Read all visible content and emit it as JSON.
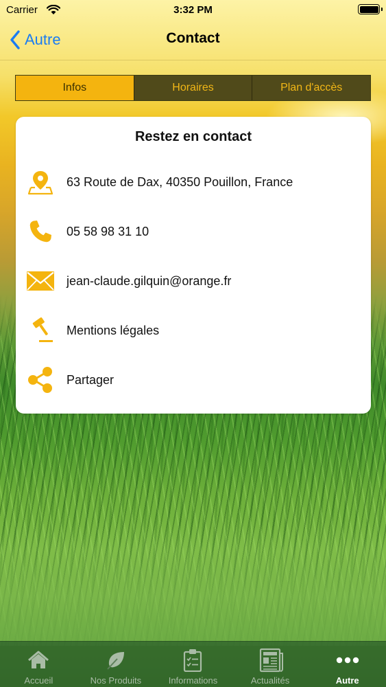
{
  "status_bar": {
    "carrier": "Carrier",
    "time": "3:32 PM"
  },
  "nav": {
    "back_label": "Autre",
    "title": "Contact"
  },
  "segments": [
    {
      "label": "Infos",
      "active": true
    },
    {
      "label": "Horaires",
      "active": false
    },
    {
      "label": "Plan d'accès",
      "active": false
    }
  ],
  "card": {
    "title": "Restez en contact",
    "rows": [
      {
        "icon": "map-pin-icon",
        "text": "63 Route de Dax, 40350 Pouillon, France"
      },
      {
        "icon": "phone-icon",
        "text": "05 58 98 31 10"
      },
      {
        "icon": "mail-icon",
        "text": "jean-claude.gilquin@orange.fr"
      },
      {
        "icon": "gavel-icon",
        "text": "Mentions légales"
      },
      {
        "icon": "share-icon",
        "text": "Partager"
      }
    ]
  },
  "tabbar": {
    "items": [
      {
        "label": "Accueil",
        "icon": "home-icon",
        "active": false
      },
      {
        "label": "Nos Produits",
        "icon": "leaf-icon",
        "active": false
      },
      {
        "label": "Informations",
        "icon": "clipboard-icon",
        "active": false
      },
      {
        "label": "Actualités",
        "icon": "newspaper-icon",
        "active": false
      },
      {
        "label": "Autre",
        "icon": "more-icon",
        "active": true
      }
    ]
  },
  "colors": {
    "accent": "#f4b40f",
    "ios_blue": "#1a7cf2",
    "segment_bg": "#504a1a"
  }
}
